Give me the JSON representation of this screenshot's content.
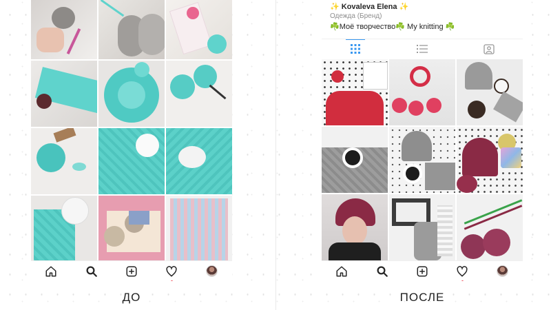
{
  "captions": {
    "before": "ДО",
    "after": "ПОСЛЕ"
  },
  "profile": {
    "name_prefix": "✨",
    "name": "Kovaleva Elena",
    "name_suffix": "✨",
    "category": "Одежда (Бренд)",
    "bio_clover": "☘️",
    "bio_text": "Моё творчество",
    "bio_text2": "My knitting",
    "bio_clover2": "☘️"
  },
  "tabs": [
    "grid-icon",
    "list-icon",
    "tagged-icon"
  ],
  "nav_icons": [
    "home-icon",
    "search-icon",
    "add-post-icon",
    "heart-icon",
    "profile-avatar"
  ],
  "colors": {
    "accent_blue": "#3897f0",
    "mint": "#5fd3cc",
    "notification_red": "#ed4956",
    "wine": "#8a2a45",
    "gray_knit": "#9c9c9c"
  }
}
